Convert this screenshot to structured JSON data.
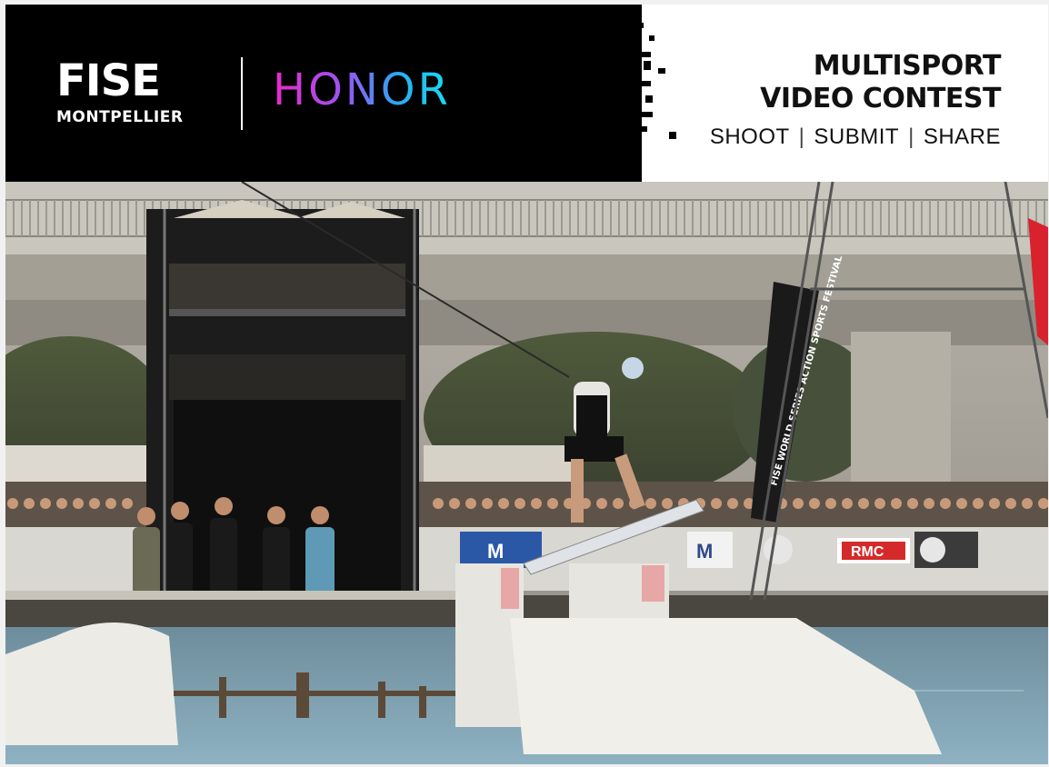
{
  "banner": {
    "fise_brand": "FISE",
    "fise_city": "MONTPELLIER",
    "partner_brand": "HONOR",
    "contest_line1": "MULTISPORT",
    "contest_line2": "VIDEO CONTEST",
    "tagline": [
      "SHOOT",
      "SUBMIT",
      "SHARE"
    ],
    "tag_separator": "|"
  },
  "photo": {
    "flag_text": "FISE WORLD SERIES ACTION SPORTS FESTIVAL",
    "sponsor_rmc": "RMC",
    "sponsor_m": "M",
    "sponsor_mv": "M"
  },
  "colors": {
    "banner_black": "#000000",
    "honor_gradient_start": "#e62cc7",
    "honor_gradient_end": "#15e0f0",
    "water": "#7fa3b5",
    "ramp": "#ecebe6",
    "flag_red": "#d8232e"
  }
}
